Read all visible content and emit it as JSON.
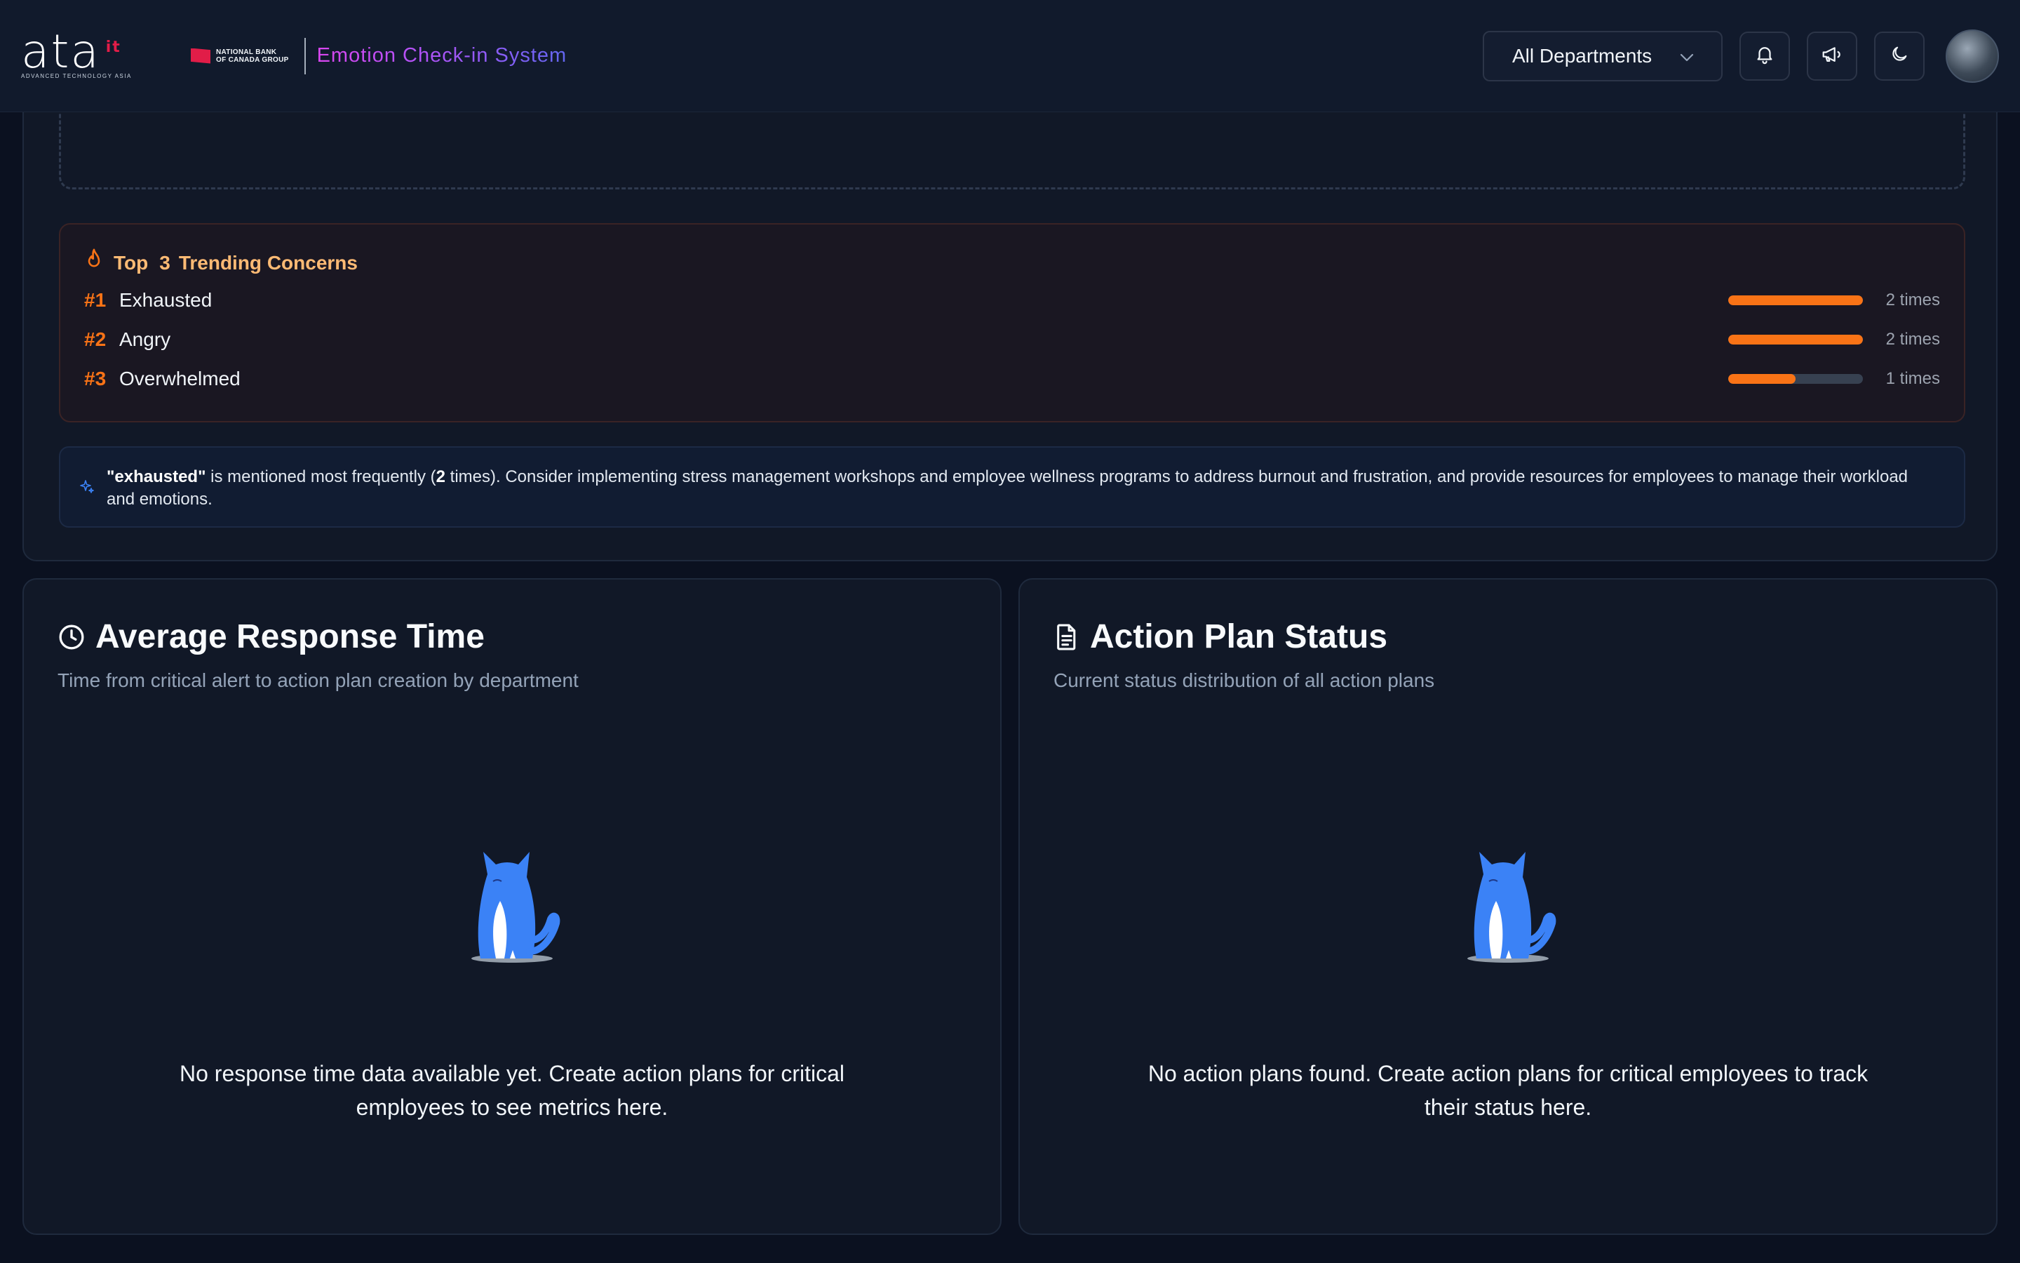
{
  "header": {
    "logo_word": "ata",
    "logo_superscript": "it",
    "logo_tagline": "ADVANCED TECHNOLOGY ASIA",
    "partner_line1": "NATIONAL BANK",
    "partner_line2": "OF CANADA GROUP",
    "app_title": "Emotion Check-in System",
    "department_select": "All Departments",
    "icons": [
      "bell-icon",
      "megaphone-icon",
      "moon-icon"
    ]
  },
  "concerns": {
    "title_prefix": "Top",
    "title_count": "3",
    "title_suffix": "Trending Concerns",
    "items": [
      {
        "rank": "#1",
        "label": "Exhausted",
        "count_text": "2 times",
        "ratio": 1.0
      },
      {
        "rank": "#2",
        "label": "Angry",
        "count_text": "2 times",
        "ratio": 1.0
      },
      {
        "rank": "#3",
        "label": "Overwhelmed",
        "count_text": "1 times",
        "ratio": 0.5
      }
    ],
    "accent_color": "#f97316"
  },
  "insight": {
    "keyword": "\"exhausted\"",
    "text_before_count": " is mentioned most frequently (",
    "count": "2",
    "text_after_count": " times). Consider implementing stress management workshops and employee wellness programs to address burnout and frustration, and provide resources for employees to manage their workload and emotions."
  },
  "response_card": {
    "title": "Average Response Time",
    "subtitle": "Time from critical alert to action plan creation by department",
    "empty_message": "No response time data available yet. Create action plans for critical employees to see metrics here."
  },
  "action_card": {
    "title": "Action Plan Status",
    "subtitle": "Current status distribution of all action plans",
    "empty_message": "No action plans found. Create action plans for critical employees to track their status here."
  }
}
